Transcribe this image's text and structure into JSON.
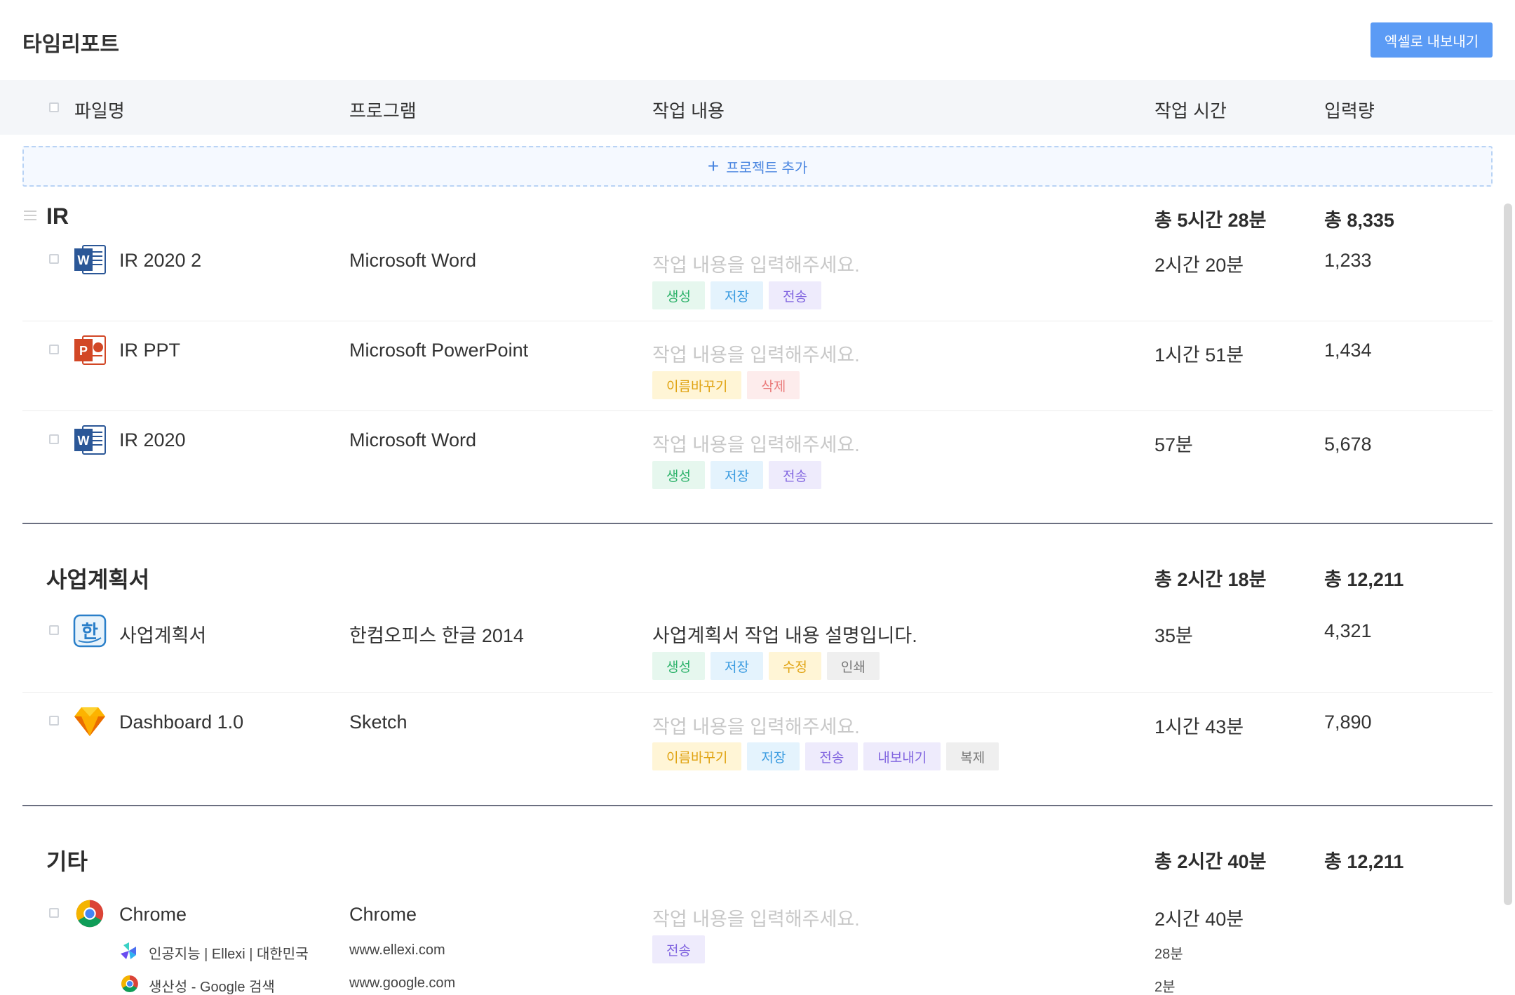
{
  "header": {
    "title": "타임리포트",
    "export_label": "엑셀로 내보내기"
  },
  "columns": {
    "filename": "파일명",
    "program": "프로그램",
    "content": "작업 내용",
    "time": "작업 시간",
    "input": "입력량"
  },
  "add_project": {
    "label": "프로젝트 추가"
  },
  "groups": [
    {
      "title": "IR",
      "total_time": "총 5시간 28분",
      "total_input": "총 8,335",
      "rows": [
        {
          "name": "IR 2020 2",
          "program": "Microsoft Word",
          "content": "작업 내용을 입력해주세요.",
          "time": "2시간 20분",
          "input": "1,233",
          "icon": "word-icon",
          "tags": [
            "생성",
            "저장",
            "전송"
          ]
        },
        {
          "name": "IR PPT",
          "program": "Microsoft PowerPoint",
          "content": "작업 내용을 입력해주세요.",
          "time": "1시간 51분",
          "input": "1,434",
          "icon": "powerpoint-icon",
          "tags": [
            "이름바꾸기",
            "삭제"
          ]
        },
        {
          "name": "IR 2020",
          "program": "Microsoft Word",
          "content": "작업 내용을 입력해주세요.",
          "time": "57분",
          "input": "5,678",
          "icon": "word-icon",
          "tags": [
            "생성",
            "저장",
            "전송"
          ]
        }
      ]
    },
    {
      "title": "사업계획서",
      "total_time": "총 2시간 18분",
      "total_input": "총 12,211",
      "rows": [
        {
          "name": "사업계획서",
          "program": "한컴오피스 한글 2014",
          "content": "사업계획서 작업 내용 설명입니다.",
          "time": "35분",
          "input": "4,321",
          "icon": "hangul-icon",
          "tags": [
            "생성",
            "저장",
            "수정",
            "인쇄"
          ]
        },
        {
          "name": "Dashboard 1.0",
          "program": "Sketch",
          "content": "작업 내용을 입력해주세요.",
          "time": "1시간 43분",
          "input": "7,890",
          "icon": "sketch-icon",
          "tags": [
            "이름바꾸기",
            "저장",
            "전송",
            "내보내기",
            "복제"
          ]
        }
      ]
    },
    {
      "title": "기타",
      "total_time": "총 2시간 40분",
      "total_input": "총 12,211",
      "rows": [
        {
          "name": "Chrome",
          "program": "Chrome",
          "content": "작업 내용을 입력해주세요.",
          "time": "2시간 40분",
          "icon": "chrome-icon",
          "tags": [
            "전송"
          ],
          "sites": [
            {
              "title": "인공지능 | Ellexi | 대한민국",
              "url": "www.ellexi.com",
              "time": "28분",
              "icon": "ellexi-icon"
            },
            {
              "title": "생산성 - Google 검색",
              "url": "www.google.com",
              "time": "2분",
              "icon": "chrome-icon"
            }
          ]
        }
      ]
    }
  ],
  "colors": {
    "accent": "#5b9bf5",
    "group_divider": "#6b6f80"
  }
}
